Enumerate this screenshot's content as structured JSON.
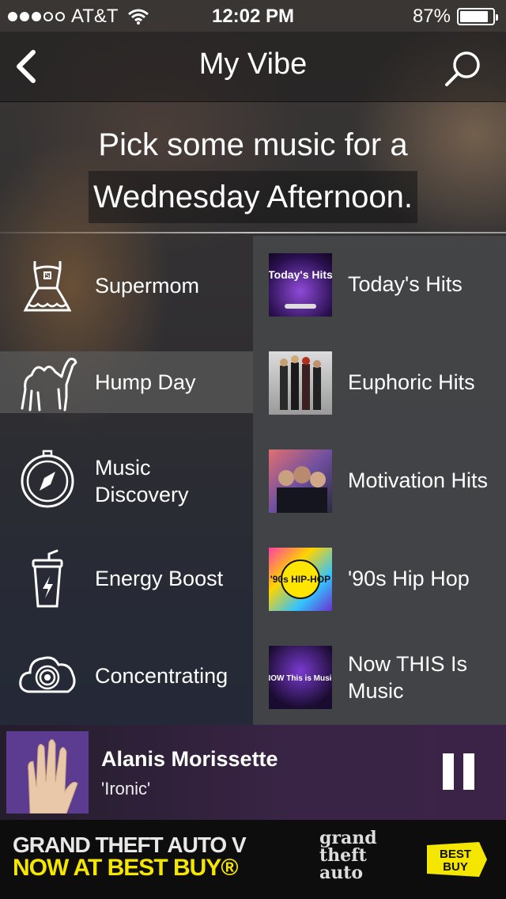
{
  "status_bar": {
    "carrier": "AT&T",
    "time": "12:02 PM",
    "battery": "87%",
    "battery_level": 0.87
  },
  "nav": {
    "title": "My Vibe"
  },
  "headline": {
    "line1": "Pick some music for a",
    "line2": "Wednesday Afternoon."
  },
  "moods": [
    {
      "label": "Supermom",
      "icon": "dress-icon"
    },
    {
      "label": "Hump Day",
      "icon": "camel-icon",
      "selected": true
    },
    {
      "label": "Music Discovery",
      "icon": "compass-icon"
    },
    {
      "label": "Energy Boost",
      "icon": "drink-cup-icon"
    },
    {
      "label": "Concentrating",
      "icon": "target-cloud-icon"
    }
  ],
  "stations": [
    {
      "label": "Today's Hits",
      "art": "Today's Hits"
    },
    {
      "label": "Euphoric Hits"
    },
    {
      "label": "Motivation Hits"
    },
    {
      "label": "'90s Hip Hop",
      "art": "'90s HIP-HOP"
    },
    {
      "label": "Now THIS Is Music",
      "art": "NOW This is Music"
    }
  ],
  "now_playing": {
    "artist": "Alanis Morissette",
    "song": "'Ironic'"
  },
  "ad": {
    "line1": "GRAND THEFT AUTO V",
    "line2": "NOW AT BEST BUY®",
    "logo_text": "grand theft auto",
    "brand": "BEST BUY"
  },
  "colors": {
    "ad_yellow": "#f5e600",
    "now_playing_bg": "#3a2446"
  }
}
